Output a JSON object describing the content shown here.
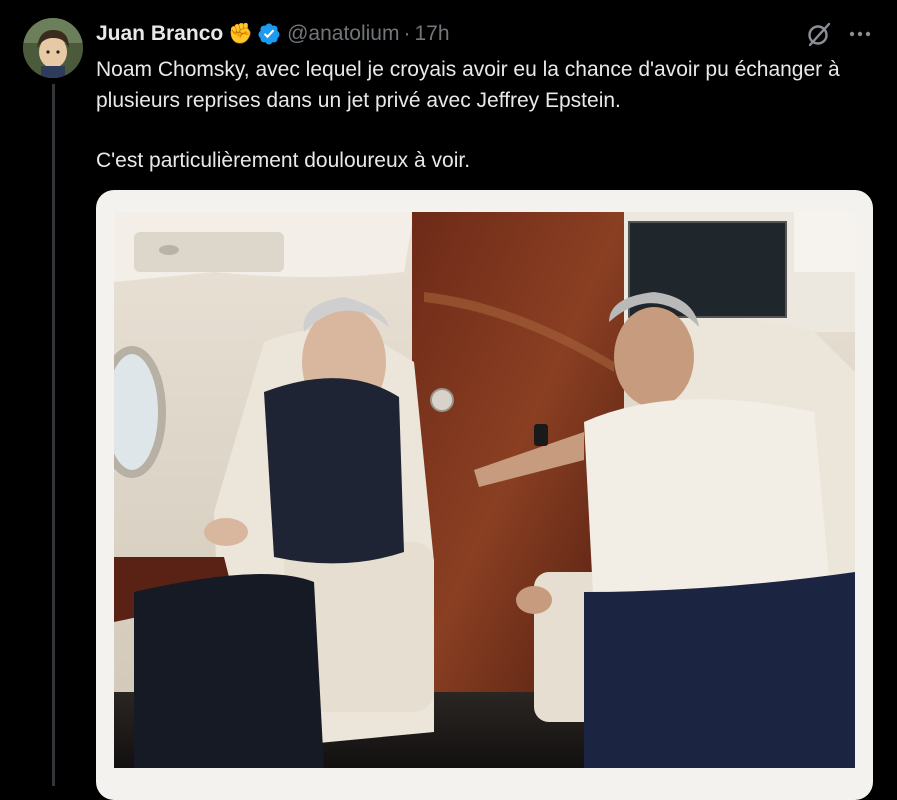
{
  "tweet": {
    "author_name": "Juan Branco",
    "emoji": "✊",
    "handle": "@anatolium",
    "separator": "·",
    "time": "17h",
    "text_p1": "Noam Chomsky, avec lequel je croyais avoir eu la chance d'avoir pu échanger à plusieurs reprises dans un jet privé avec Jeffrey Epstein.",
    "text_p2": "C'est particulièrement douloureux à voir."
  },
  "icons": {
    "verified": "verified-badge-icon",
    "grok": "grok-icon",
    "more": "more-options-icon"
  },
  "colors": {
    "background": "#000000",
    "text": "#e7e9ea",
    "secondary_text": "#71767b",
    "verified_blue": "#1d9bf0"
  }
}
